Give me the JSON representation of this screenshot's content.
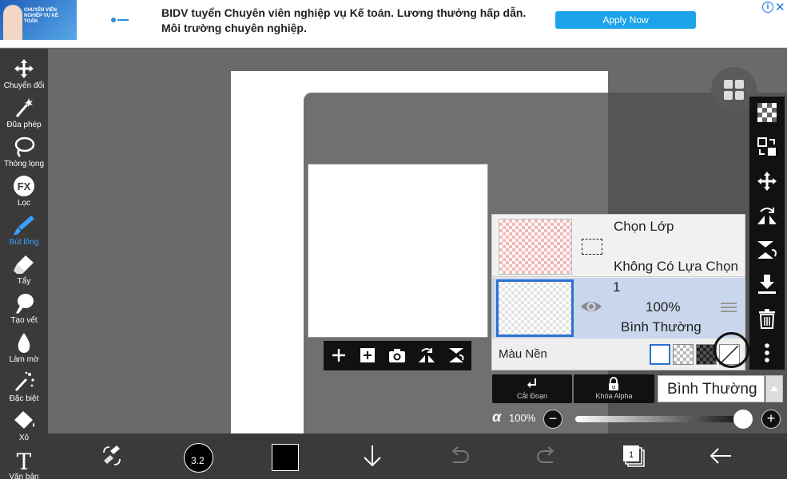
{
  "ad": {
    "thumb_title": "CHUYÊN VIÊN NGHIỆP VỤ KẾ TOÁN",
    "headline": "BIDV tuyển Chuyên viên nghiệp vụ Kế toán. Lương thưởng hấp dẫn. Môi trường chuyên nghiệp.",
    "cta_label": "Apply Now",
    "info_glyph": "i",
    "close_glyph": "✕"
  },
  "tools": [
    {
      "name": "move",
      "label": "Chuyển đổi",
      "icon": "move-icon"
    },
    {
      "name": "magic-wand",
      "label": "Đũa phép",
      "icon": "magic-wand-icon"
    },
    {
      "name": "lasso",
      "label": "Thòng lọng",
      "icon": "lasso-icon"
    },
    {
      "name": "filter",
      "label": "Lọc",
      "icon": "fx-icon",
      "glyph": "FX"
    },
    {
      "name": "brush",
      "label": "Bút lông",
      "icon": "brush-icon",
      "active": true
    },
    {
      "name": "eraser",
      "label": "Tẩy",
      "icon": "eraser-icon"
    },
    {
      "name": "smudge",
      "label": "Tạo vết",
      "icon": "smudge-icon"
    },
    {
      "name": "blur",
      "label": "Làm mờ",
      "icon": "blur-icon"
    },
    {
      "name": "special",
      "label": "Đặc biệt",
      "icon": "special-icon"
    },
    {
      "name": "fill",
      "label": "Xô",
      "icon": "bucket-icon"
    },
    {
      "name": "text",
      "label": "Văn bản",
      "icon": "text-icon",
      "glyph": "T"
    }
  ],
  "layers": {
    "selection_row": {
      "title": "Chọn Lớp",
      "subtitle": "Không Có Lựa Chọn"
    },
    "layer1": {
      "number": "1",
      "opacity": "100%",
      "blend_mode": "Bình Thường"
    },
    "background": {
      "label": "Màu Nền"
    }
  },
  "layer_actions": {
    "clipping_label": "Cắt Đoạn",
    "alpha_lock_label": "Khóa Alpha",
    "blend_mode_value": "Bình Thường"
  },
  "alpha": {
    "symbol": "α",
    "value": "100%",
    "minus": "−",
    "plus": "+"
  },
  "bottom": {
    "brush_size": "3.2",
    "layer_count": "1"
  },
  "colors": {
    "accent": "#3aa0ff",
    "selected_layer_bg": "#c9d6ec",
    "selected_border": "#2d6fd2",
    "toolbar_bg": "#3a3a3a",
    "cta": "#1aa3e8"
  }
}
